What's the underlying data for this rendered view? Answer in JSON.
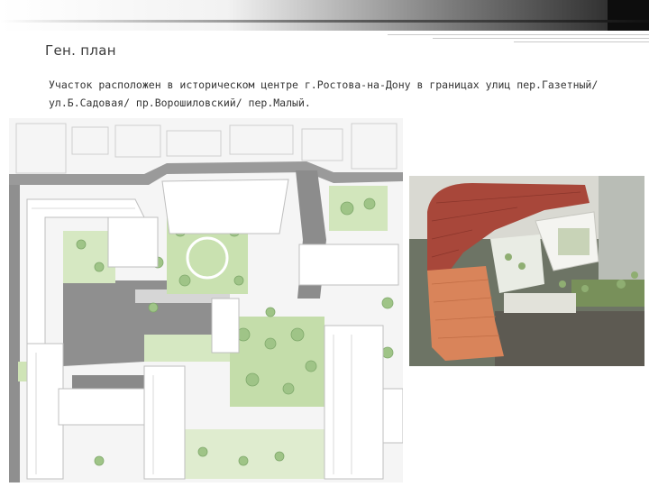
{
  "slide": {
    "title": "Ген. план",
    "description": "Участок расположен в историческом центре г.Ростова-на-Дону в границах улиц пер.Газетный/ ул.Б.Садовая/ пр.Ворошиловский/ пер.Малый."
  },
  "colors": {
    "road": "#8f8f8f",
    "green": "#c9e1b0",
    "building": "#ffffff",
    "roof_red": "#a8473a",
    "roof_orange": "#d9845a"
  }
}
